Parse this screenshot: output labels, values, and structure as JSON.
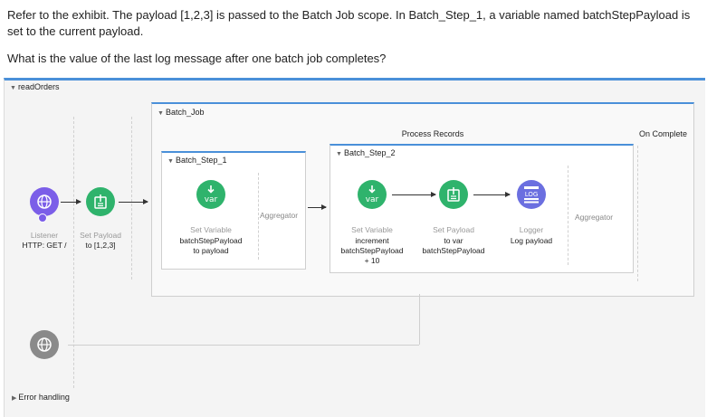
{
  "question": {
    "line1": "Refer to the exhibit. The payload [1,2,3] is passed to the Batch Job scope. In Batch_Step_1, a variable named batchStepPayload is set to the current payload.",
    "line2": "What is the value of the last log message after one batch job completes?"
  },
  "flow": {
    "name": "readOrders",
    "listener": {
      "type": "Listener",
      "label": "HTTP: GET /"
    },
    "set_payload": {
      "type": "Set Payload",
      "label": "to [1,2,3]"
    },
    "error_handling": "Error handling"
  },
  "batch_job": {
    "name": "Batch_Job",
    "process_records": "Process Records",
    "on_complete": "On Complete",
    "step1": {
      "name": "Batch_Step_1",
      "aggregator": "Aggregator",
      "set_variable": {
        "icon_text": "var",
        "type": "Set Variable",
        "label_line1": "batchStepPayload",
        "label_line2": "to payload"
      }
    },
    "step2": {
      "name": "Batch_Step_2",
      "aggregator": "Aggregator",
      "set_variable": {
        "icon_text": "var",
        "type": "Set Variable",
        "label_line1": "increment",
        "label_line2": "batchStepPayload",
        "label_line3": "+ 10"
      },
      "set_payload": {
        "type": "Set Payload",
        "label_line1": "to var",
        "label_line2": "batchStepPayload"
      },
      "logger": {
        "icon_text": "LOG",
        "type": "Logger",
        "label": "Log payload"
      }
    }
  },
  "colors": {
    "accent": "#4a90d9",
    "green": "#2fb36c",
    "purple": "#6b6fe0",
    "globe": "#7b5ee8",
    "gray": "#8a8a8a"
  }
}
